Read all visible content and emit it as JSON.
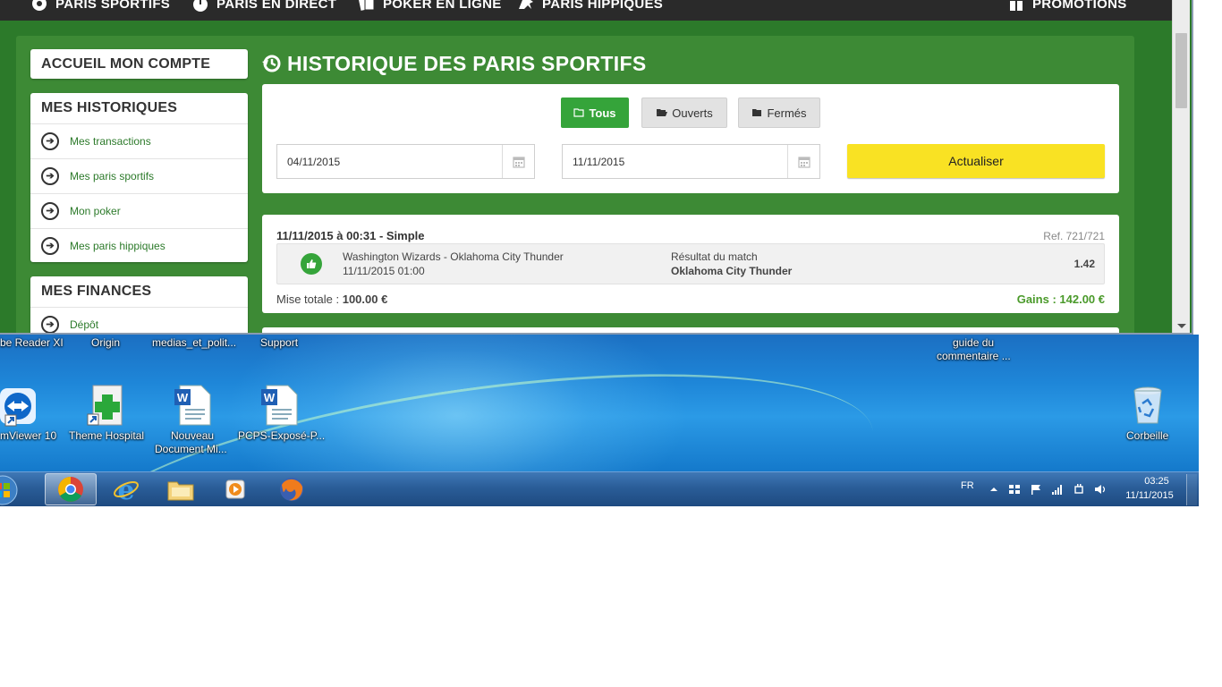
{
  "nav": {
    "items": [
      {
        "label": "PARIS SPORTIFS",
        "icon": "soccer-ball-icon"
      },
      {
        "label": "PARIS EN DIRECT",
        "icon": "stopwatch-icon"
      },
      {
        "label": "POKER EN LIGNE",
        "icon": "cards-icon"
      },
      {
        "label": "PARIS HIPPIQUES",
        "icon": "horse-icon"
      }
    ],
    "promotions": "PROMOTIONS"
  },
  "sidebar": {
    "account": "ACCUEIL MON COMPTE",
    "histories": {
      "title": "MES HISTORIQUES",
      "items": [
        "Mes transactions",
        "Mes paris sportifs",
        "Mon poker",
        "Mes paris hippiques"
      ]
    },
    "finances": {
      "title": "MES FINANCES",
      "items": [
        "Dépôt"
      ]
    }
  },
  "main": {
    "title": "HISTORIQUE DES PARIS SPORTIFS",
    "filters": {
      "all": "Tous",
      "open": "Ouverts",
      "closed": "Fermés"
    },
    "date_from": "04/11/2015",
    "date_to": "11/11/2015",
    "refresh": "Actualiser"
  },
  "bet": {
    "header": "11/11/2015 à 00:31 - Simple",
    "ref": "Ref. 721/721",
    "match": "Washington Wizards - Oklahoma City Thunder",
    "match_date": "11/11/2015 01:00",
    "market": "Résultat du match",
    "selection": "Oklahoma City Thunder",
    "odds": "1.42",
    "stake_label": "Mise totale :",
    "stake_value": "100.00 €",
    "winnings": "Gains : 142.00 €"
  },
  "desktop": {
    "top_labels": [
      "be Reader XI",
      "Origin",
      "medias_et_polit...",
      "Support",
      "guide du",
      "commentaire ..."
    ],
    "icons": [
      {
        "label": "mViewer 10",
        "icon": "teamviewer-icon"
      },
      {
        "label": "Theme Hospital",
        "icon": "theme-hospital-icon"
      },
      {
        "label": "Nouveau",
        "label2": "Document Mi...",
        "icon": "word-document-icon"
      },
      {
        "label": "PCPS-Exposé-P...",
        "icon": "word-document-icon"
      },
      {
        "label": "Corbeille",
        "icon": "recycle-bin-icon"
      }
    ]
  },
  "taskbar": {
    "apps": [
      "chrome",
      "internet-explorer",
      "file-explorer",
      "media-player",
      "firefox"
    ],
    "lang": "FR",
    "time": "03:25",
    "date": "11/11/2015"
  },
  "colors": {
    "brand_green": "#2c7a2a",
    "button_green": "#35a43a",
    "refresh_yellow": "#f9e223",
    "win_green": "#4a9a2a"
  }
}
